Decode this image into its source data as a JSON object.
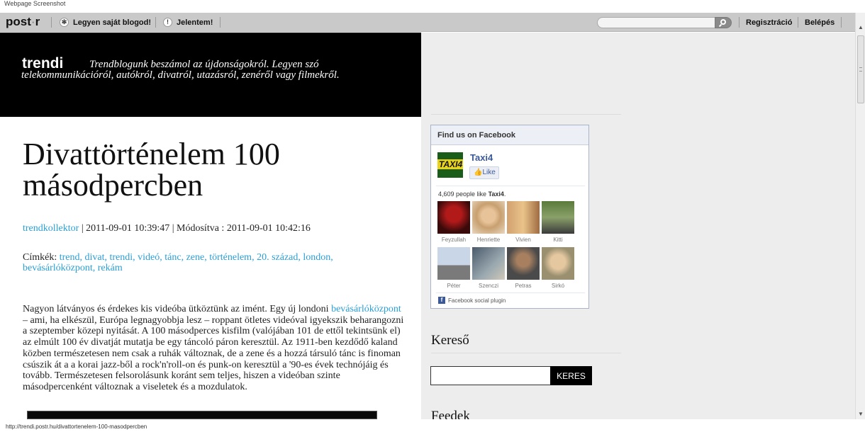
{
  "caption": "Webpage Screenshot",
  "topbar": {
    "logo_main": "post",
    "logo_dot": "·",
    "logo_end": "r",
    "own_blog": "Legyen saját blogod!",
    "own_blog_icon": "✻",
    "report": "Jelentem!",
    "report_icon": "!",
    "search_placeholder": "",
    "register": "Regisztráció",
    "login": "Belépés"
  },
  "header": {
    "blog_name": "trendi",
    "tagline": "Trendblogunk beszámol az újdonságokról. Legyen szó telekommunikációról, autókról, divatról, utazásról, zenéről vagy filmekről."
  },
  "post": {
    "title": "Divattörténelem 100 másodpercben",
    "author": "trendkollektor",
    "meta_sep1": " | ",
    "date": "2011-09-01 10:39:47",
    "meta_sep2": " | ",
    "modified_label": "Módosítva : ",
    "modified": "2011-09-01 10:42:16",
    "tags_label": "Címkék: ",
    "tags": "trend, divat, trendi, videó, tánc, zene, történelem, 20. század, london, bevásárlóközpont, rekám",
    "body_1": "Nagyon látványos és érdekes kis videóba ütköztünk az imént. Egy új londoni ",
    "body_link": "bevásárlóközpont",
    "body_2": " – ami, ha elkészül, Európa legnagyobbja lesz – roppant ötletes videóval igyekszik beharangozni a szeptember közepi nyitását. A 100 másodperces kisfilm (valójában 101 de ettől tekintsünk el) az elmúlt 100 év divatját mutatja be egy táncoló páron keresztül. Az 1911-ben kezdődő kaland közben természetesen nem csak a ruhák változnak, de a zene és a hozzá társuló tánc is finoman csúszik át a a korai jazz-ből a rock'n'roll-on és punk-on keresztül a '90-es évek technójáig és tovább. Természetesen felsorolásunk koránt sem teljes, hiszen a videóban szinte másodpercenként változnak a viseletek és a mozdulatok."
  },
  "facebook": {
    "header": "Find us on Facebook",
    "logo_text": "TAXI4",
    "page_name": "Taxi4",
    "like_label": "Like",
    "count_prefix": "4,609 people like ",
    "count_page": "Taxi4",
    "count_suffix": ".",
    "people": [
      "Feyzullah",
      "Henriette",
      "Vivien",
      "Kitti",
      "Péter",
      "Szenczi",
      "Petras",
      "Sirkó"
    ],
    "plugin": "Facebook social plugin"
  },
  "sidebar": {
    "search_title": "Kereső",
    "search_button": "KERES",
    "feeds_title": "Feedek"
  },
  "status_url": "http://trendi.postr.hu/divattortenelem-100-masodpercben",
  "colors": {
    "link": "#2a9fd6",
    "fb_blue": "#3b5998"
  }
}
